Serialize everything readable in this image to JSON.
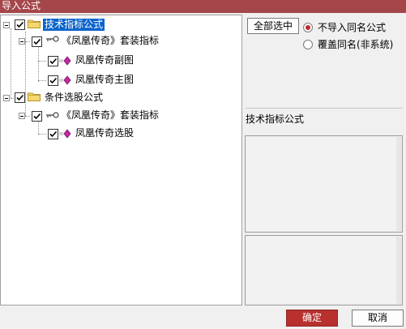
{
  "window": {
    "title": "导入公式"
  },
  "tree": {
    "g1": {
      "label": "技术指标公式",
      "sub": {
        "label": "《凤凰传奇》套装指标",
        "items": [
          "凤凰传奇副图",
          "凤凰传奇主图"
        ]
      }
    },
    "g2": {
      "label": "条件选股公式",
      "sub": {
        "label": "《凤凰传奇》套装指标",
        "items": [
          "凤凰传奇选股"
        ]
      }
    }
  },
  "options": {
    "select_all": "全部选中",
    "radio_no_import": "不导入同名公式",
    "radio_overwrite": "覆盖同名(非系统)"
  },
  "details": {
    "formula_name": "技术指标公式"
  },
  "footer": {
    "ok": "确定",
    "cancel": "取消"
  },
  "colors": {
    "titlebar": "#a4464a",
    "accent": "#b8312f",
    "selection": "#0a64cc",
    "diamond": "#c02aa0"
  }
}
